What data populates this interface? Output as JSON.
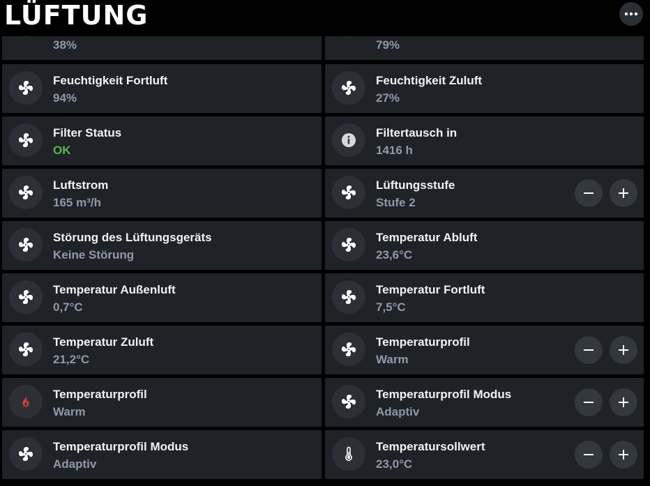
{
  "header": {
    "title": "LÜFTUNG",
    "menu_icon": "more-horizontal-icon"
  },
  "cards": [
    {
      "value": "38%",
      "icon": "fan-icon"
    },
    {
      "value": "79%",
      "icon": "fan-icon"
    },
    {
      "label": "Feuchtigkeit Fortluft",
      "value": "94%",
      "icon": "fan-icon"
    },
    {
      "label": "Feuchtigkeit Zuluft",
      "value": "27%",
      "icon": "fan-icon"
    },
    {
      "label": "Filter Status",
      "value": "OK",
      "icon": "fan-icon",
      "value_color": "#5ab552"
    },
    {
      "label": "Filtertausch in",
      "value": "1416 h",
      "icon": "info-icon"
    },
    {
      "label": "Luftstrom",
      "value": "165 m³/h",
      "icon": "fan-icon"
    },
    {
      "label": "Lüftungsstufe",
      "value": "Stufe 2",
      "icon": "fan-icon",
      "controls": true
    },
    {
      "label": "Störung des Lüftungsgeräts",
      "value": "Keine Störung",
      "icon": "fan-icon"
    },
    {
      "label": "Temperatur Abluft",
      "value": "23,6°C",
      "icon": "fan-icon"
    },
    {
      "label": "Temperatur Außenluft",
      "value": "0,7°C",
      "icon": "fan-icon"
    },
    {
      "label": "Temperatur Fortluft",
      "value": "7,5°C",
      "icon": "fan-icon"
    },
    {
      "label": "Temperatur Zuluft",
      "value": "21,2°C",
      "icon": "fan-icon"
    },
    {
      "label": "Temperaturprofil",
      "value": "Warm",
      "icon": "fan-icon",
      "controls": true
    },
    {
      "label": "Temperaturprofil",
      "value": "Warm",
      "icon": "flame-icon",
      "icon_color": "#e53935"
    },
    {
      "label": "Temperaturprofil Modus",
      "value": "Adaptiv",
      "icon": "fan-icon",
      "controls": true
    },
    {
      "label": "Temperaturprofil Modus",
      "value": "Adaptiv",
      "icon": "fan-icon"
    },
    {
      "label": "Temperatursollwert",
      "value": "23,0°C",
      "icon": "thermometer-icon",
      "controls": true
    }
  ],
  "colors": {
    "background": "#000000",
    "card": "#1f2227",
    "icon_bg": "#2c3036",
    "value_text": "#8e9aaa",
    "ok_green": "#5ab552",
    "flame_red": "#e53935"
  }
}
